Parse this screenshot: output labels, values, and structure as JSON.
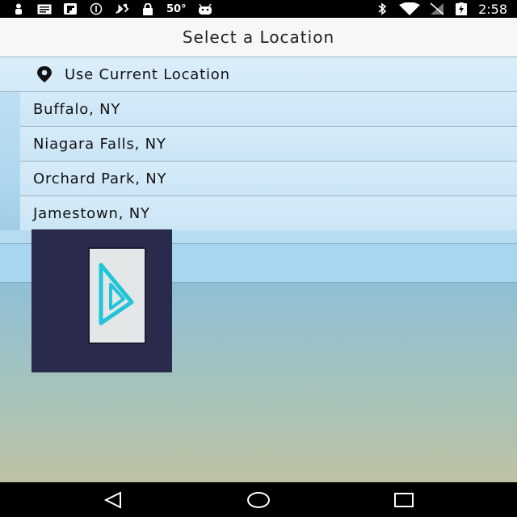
{
  "status_bar": {
    "temperature": "50°",
    "time": "2:58",
    "icons": [
      "person-icon",
      "message-icon",
      "flipboard-icon",
      "sync-icon",
      "satellite-icon",
      "lock-icon",
      "android-icon",
      "bluetooth-icon",
      "wifi-icon",
      "signal-icon",
      "battery-charging-icon"
    ]
  },
  "header": {
    "title": "Select a Location"
  },
  "list": {
    "current_location": "Use Current Location",
    "cities": [
      "Buffalo, NY",
      "Niagara Falls, NY",
      "Orchard Park, NY",
      "Jamestown, NY"
    ]
  },
  "colors": {
    "header_bg": "#f7f7f7",
    "list_bg": "#d3e9f8",
    "ad_bg": "#2a2a4d",
    "logo_cyan": "#22c4d6"
  }
}
